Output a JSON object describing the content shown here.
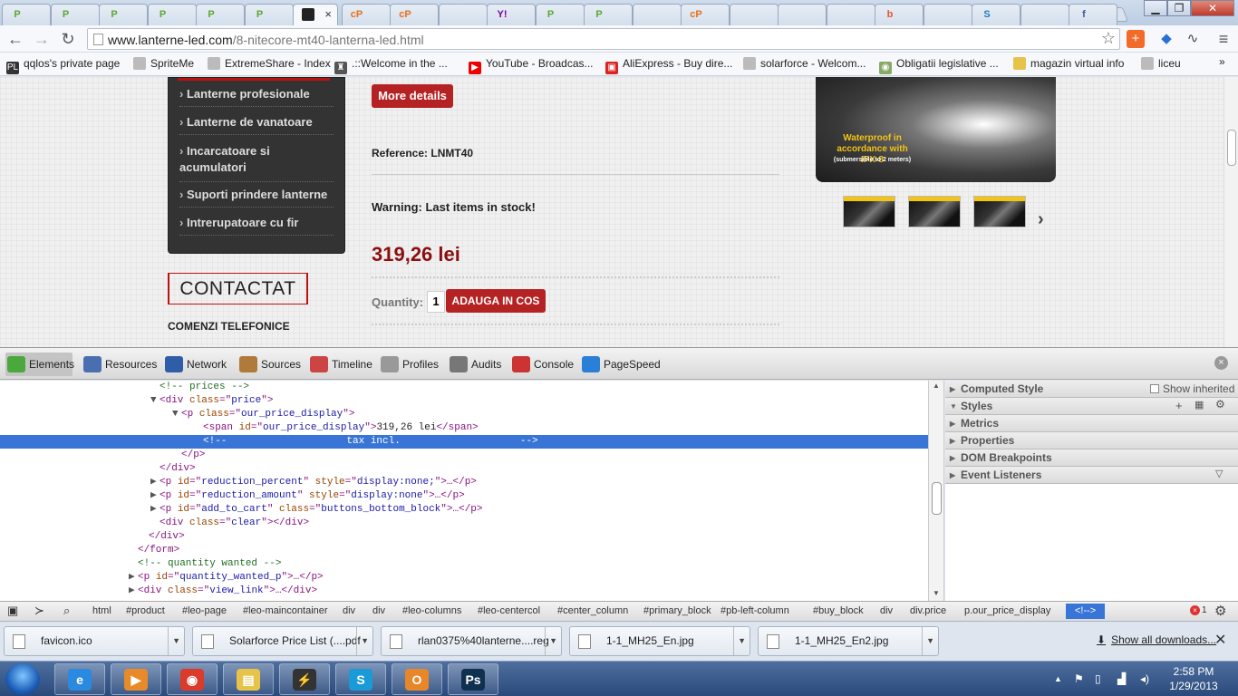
{
  "tabs": {
    "active_close": "×",
    "favicons": [
      "P",
      "P",
      "P",
      "P",
      "P",
      "P",
      "",
      "cP",
      "cP",
      "",
      "Y!",
      "P",
      "P",
      "",
      "cP",
      "",
      "",
      "",
      "b",
      "",
      "S",
      "",
      "f"
    ],
    "colors": [
      "#5aa832",
      "#5aa832",
      "#5aa832",
      "#5aa832",
      "#5aa832",
      "#5aa832",
      "#333",
      "#e66f1c",
      "#e66f1c",
      "#7a8aa5",
      "#7b0099",
      "#5aa832",
      "#5aa832",
      "#ccc",
      "#e66f1c",
      "#4a8a2a",
      "#2a6fd6",
      "#e8552b",
      "#e8552b",
      "#e87a1b",
      "#1a7fc1",
      "#2a6fd6",
      "#3b5998"
    ]
  },
  "window": {
    "min": "▁",
    "max": "❐",
    "close": "✕"
  },
  "toolbar": {
    "back": "←",
    "forward": "→",
    "reload": "↻",
    "url_host": "www.lanterne-led.com",
    "url_path": "/8-nitecore-mt40-lanterna-led.html",
    "star": "☆",
    "menu": "≡"
  },
  "bookmarks": [
    {
      "label": "qqlos's private page",
      "icon": "PL",
      "color": "#333"
    },
    {
      "label": "SpriteMe",
      "icon": "",
      "color": "#bbb"
    },
    {
      "label": "ExtremeShare - Index",
      "icon": "",
      "color": "#bbb"
    },
    {
      "label": ".::Welcome in the ...",
      "icon": "♜",
      "color": "#555"
    },
    {
      "label": "YouTube - Broadcas...",
      "icon": "▶",
      "color": "#e00"
    },
    {
      "label": "AliExpress - Buy dire...",
      "icon": "▣",
      "color": "#d22"
    },
    {
      "label": "solarforce - Welcom...",
      "icon": "",
      "color": "#bbb"
    },
    {
      "label": "Obligatii legislative ...",
      "icon": "◉",
      "color": "#8a6"
    },
    {
      "label": "magazin virtual info",
      "icon": "",
      "color": "#e8c34a"
    },
    {
      "label": "liceu",
      "icon": "",
      "color": "#bbb"
    }
  ],
  "bookmarks_more": "»",
  "page": {
    "categories": [
      "Lanterne profesionale",
      "Lanterne de vanatoare",
      "Incarcatoare si acumulatori",
      "Suporti prindere lanterne",
      "Intrerupatoare cu fir"
    ],
    "contactat": "CONTACTAT",
    "comenzi": "COMENZI TELEFONICE",
    "more_details": "More details",
    "reference_label": "Reference:",
    "reference_value": "LNMT40",
    "warning": "Warning: Last items in stock!",
    "price": "319,26 lei",
    "quantity_label": "Quantity:",
    "quantity_value": "1",
    "add_to_cart": "ADAUGA IN COS",
    "image_caption": "Waterproof in accordance with IPX-8",
    "image_caption_small": "(submersible to 2 meters)",
    "carousel_next": "›"
  },
  "devtools": {
    "tabs": [
      {
        "label": "Elements",
        "color": "#4aa83c"
      },
      {
        "label": "Resources",
        "color": "#4a6fb0"
      },
      {
        "label": "Network",
        "color": "#2f5da8"
      },
      {
        "label": "Sources",
        "color": "#b07a3a"
      },
      {
        "label": "Timeline",
        "color": "#c44"
      },
      {
        "label": "Profiles",
        "color": "#999"
      },
      {
        "label": "Audits",
        "color": "#777"
      },
      {
        "label": "Console",
        "color": "#c33"
      },
      {
        "label": "PageSpeed",
        "color": "#2a7fd6"
      }
    ],
    "close": "×",
    "dom_lines": [
      {
        "indent": 14,
        "tri": "",
        "parts": [
          [
            "c",
            "<!-- prices -->"
          ]
        ]
      },
      {
        "indent": 14,
        "tri": "▼",
        "parts": [
          [
            "t",
            "<div "
          ],
          [
            "an",
            "class"
          ],
          [
            "t",
            "=\""
          ],
          [
            "av",
            "price"
          ],
          [
            "t",
            "\">"
          ]
        ]
      },
      {
        "indent": 16,
        "tri": "▼",
        "parts": [
          [
            "t",
            "<p "
          ],
          [
            "an",
            "class"
          ],
          [
            "t",
            "=\""
          ],
          [
            "av",
            "our_price_display"
          ],
          [
            "t",
            "\">"
          ]
        ]
      },
      {
        "indent": 18,
        "tri": "",
        "parts": [
          [
            "t",
            "<span "
          ],
          [
            "an",
            "id"
          ],
          [
            "t",
            "=\""
          ],
          [
            "av",
            "our_price_display"
          ],
          [
            "t",
            "\">"
          ],
          [
            "x",
            "319,26 lei"
          ],
          [
            "t",
            "</span>"
          ]
        ]
      },
      {
        "indent": 18,
        "tri": "",
        "sel": true,
        "parts": [
          [
            "c",
            "<!--                    tax incl.                    -->"
          ]
        ]
      },
      {
        "indent": 16,
        "tri": "",
        "parts": [
          [
            "t",
            "</p>"
          ]
        ]
      },
      {
        "indent": 14,
        "tri": "",
        "parts": [
          [
            "t",
            "</div>"
          ]
        ]
      },
      {
        "indent": 14,
        "tri": "▶",
        "parts": [
          [
            "t",
            "<p "
          ],
          [
            "an",
            "id"
          ],
          [
            "t",
            "=\""
          ],
          [
            "av",
            "reduction_percent"
          ],
          [
            "t",
            "\" "
          ],
          [
            "an",
            "style"
          ],
          [
            "t",
            "=\""
          ],
          [
            "av",
            "display:none;"
          ],
          [
            "t",
            "\">…</p>"
          ]
        ]
      },
      {
        "indent": 14,
        "tri": "▶",
        "parts": [
          [
            "t",
            "<p "
          ],
          [
            "an",
            "id"
          ],
          [
            "t",
            "=\""
          ],
          [
            "av",
            "reduction_amount"
          ],
          [
            "t",
            "\" "
          ],
          [
            "an",
            "style"
          ],
          [
            "t",
            "=\""
          ],
          [
            "av",
            "display:none"
          ],
          [
            "t",
            "\">…</p>"
          ]
        ]
      },
      {
        "indent": 14,
        "tri": "▶",
        "parts": [
          [
            "t",
            "<p "
          ],
          [
            "an",
            "id"
          ],
          [
            "t",
            "=\""
          ],
          [
            "av",
            "add_to_cart"
          ],
          [
            "t",
            "\" "
          ],
          [
            "an",
            "class"
          ],
          [
            "t",
            "=\""
          ],
          [
            "av",
            "buttons_bottom_block"
          ],
          [
            "t",
            "\">…</p>"
          ]
        ]
      },
      {
        "indent": 14,
        "tri": "",
        "parts": [
          [
            "t",
            "<div "
          ],
          [
            "an",
            "class"
          ],
          [
            "t",
            "=\""
          ],
          [
            "av",
            "clear"
          ],
          [
            "t",
            "\"></div>"
          ]
        ]
      },
      {
        "indent": 13,
        "tri": "",
        "parts": [
          [
            "t",
            "</div>"
          ]
        ]
      },
      {
        "indent": 12,
        "tri": "",
        "parts": [
          [
            "t",
            "</form>"
          ]
        ]
      },
      {
        "indent": 12,
        "tri": "",
        "parts": [
          [
            "c",
            "<!-- quantity wanted -->"
          ]
        ]
      },
      {
        "indent": 12,
        "tri": "▶",
        "parts": [
          [
            "t",
            "<p "
          ],
          [
            "an",
            "id"
          ],
          [
            "t",
            "=\""
          ],
          [
            "av",
            "quantity_wanted_p"
          ],
          [
            "t",
            "\">…</p>"
          ]
        ]
      },
      {
        "indent": 12,
        "tri": "▶",
        "parts": [
          [
            "t",
            "<div "
          ],
          [
            "an",
            "class"
          ],
          [
            "t",
            "=\""
          ],
          [
            "av",
            "view_link"
          ],
          [
            "t",
            "\">…</div>"
          ]
        ]
      }
    ],
    "side_panes": [
      {
        "label": "Computed Style",
        "open": false
      },
      {
        "label": "Styles",
        "open": true
      },
      {
        "label": "Metrics",
        "open": false
      },
      {
        "label": "Properties",
        "open": false
      },
      {
        "label": "DOM Breakpoints",
        "open": false
      },
      {
        "label": "Event Listeners",
        "open": false
      }
    ],
    "show_inherited": "Show inherited",
    "breadcrumbs": [
      "html",
      "#product",
      "#leo-page",
      "#leo-maincontainer",
      "div",
      "div",
      "#leo-columns",
      "#leo-centercol",
      "#center_column",
      "#primary_block",
      "#pb-left-column",
      "#buy_block",
      "div",
      "div.price",
      "p.our_price_display",
      "<!-->"
    ],
    "error_count": "1"
  },
  "downloads": {
    "items": [
      "favicon.ico",
      "Solarforce Price List (....pdf",
      "rlan0375%40lanterne....reg",
      "1-1_MH25_En.jpg",
      "1-1_MH25_En2.jpg"
    ],
    "show_all": "Show all downloads...",
    "close": "✕"
  },
  "taskbar": {
    "apps": [
      {
        "glyph": "e",
        "color": "#2a8adf"
      },
      {
        "glyph": "▶",
        "color": "#e88a2a"
      },
      {
        "glyph": "◉",
        "color": "#db3b2b"
      },
      {
        "glyph": "▤",
        "color": "#e8c34a"
      },
      {
        "glyph": "⚡",
        "color": "#333"
      },
      {
        "glyph": "S",
        "color": "#1a9ad6"
      },
      {
        "glyph": "O",
        "color": "#e8862a"
      },
      {
        "glyph": "Ps",
        "color": "#10304f"
      }
    ],
    "time": "2:58 PM",
    "date": "1/29/2013"
  }
}
